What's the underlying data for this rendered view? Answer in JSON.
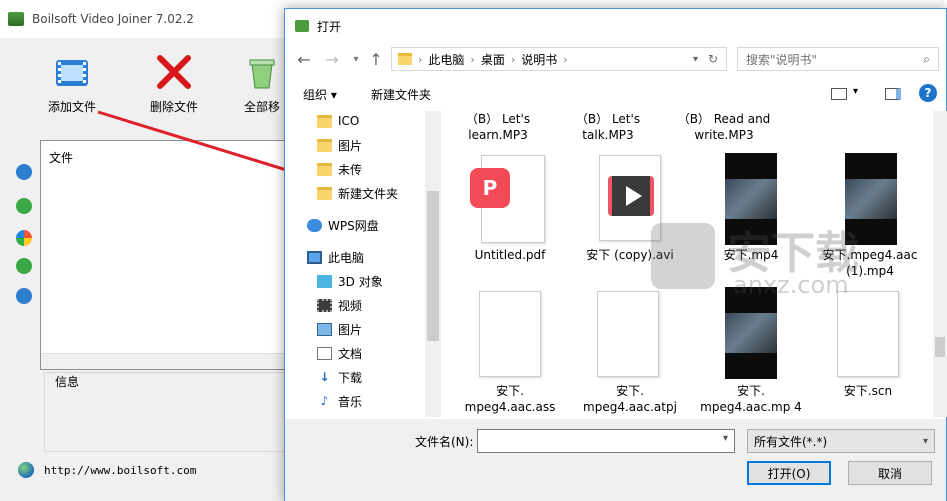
{
  "app": {
    "title": "Boilsoft Video Joiner 7.02.2",
    "toolbar": {
      "add_label": "添加文件",
      "delete_label": "删除文件",
      "all_label": "全部移"
    },
    "file_list_header": "文件",
    "info_header": "信息",
    "url": "http://www.boilsoft.com"
  },
  "dialog": {
    "title": "打开",
    "breadcrumb": [
      "此电脑",
      "桌面",
      "说明书"
    ],
    "search_placeholder": "搜索\"说明书\"",
    "organize_label": "组织 ▾",
    "new_folder_label": "新建文件夹",
    "tree": [
      {
        "label": "ICO",
        "icon": "folder-icon"
      },
      {
        "label": "图片",
        "icon": "folder-icon"
      },
      {
        "label": "未传",
        "icon": "folder-icon"
      },
      {
        "label": "新建文件夹",
        "icon": "folder-icon"
      },
      {
        "label": "WPS网盘",
        "icon": "cloud-icon"
      },
      {
        "label": "此电脑",
        "icon": "computer-icon"
      },
      {
        "label": "3D 对象",
        "icon": "cube-icon"
      },
      {
        "label": "视频",
        "icon": "video-icon"
      },
      {
        "label": "图片",
        "icon": "pictures-icon"
      },
      {
        "label": "文档",
        "icon": "document-icon"
      },
      {
        "label": "下载",
        "icon": "download-icon"
      },
      {
        "label": "音乐",
        "icon": "music-icon"
      }
    ],
    "files": [
      {
        "name": "（B） Let's learn.MP3",
        "kind": "none"
      },
      {
        "name": "（B） Let's talk.MP3",
        "kind": "none"
      },
      {
        "name": "（B） Read and write.MP3",
        "kind": "none"
      },
      {
        "name": "Untitled.pdf",
        "kind": "pdf"
      },
      {
        "name": "安下 (copy).avi",
        "kind": "avi"
      },
      {
        "name": "安下.mp4",
        "kind": "video"
      },
      {
        "name": "安下.mpeg4.aac (1).mp4",
        "kind": "video"
      },
      {
        "name": "安下. mpeg4.aac.ass",
        "kind": "doc"
      },
      {
        "name": "安下. mpeg4.aac.atpj",
        "kind": "doc"
      },
      {
        "name": "安下. mpeg4.aac.mp 4",
        "kind": "video"
      },
      {
        "name": "安下.scn",
        "kind": "doc"
      }
    ],
    "filename_label": "文件名(N):",
    "filename_value": "",
    "filetype_value": "所有文件(*.*)",
    "open_label": "打开(O)",
    "cancel_label": "取消"
  },
  "watermark": {
    "text": "安下载",
    "subtext": "anxz.com"
  },
  "colors": {
    "accent": "#0078d7",
    "arrow": "#e0202a",
    "folder": "#f7d56b"
  }
}
